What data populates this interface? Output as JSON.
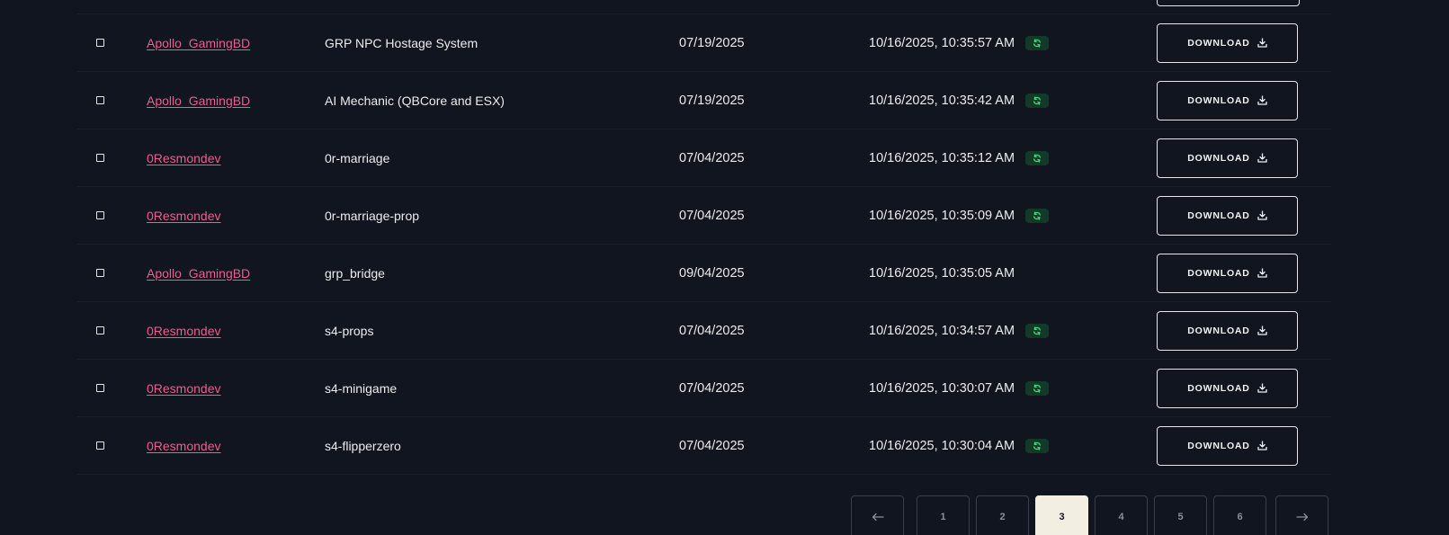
{
  "table": {
    "download_label": "DOWNLOAD",
    "rows": [
      {
        "author": "Apollo_GamingBD",
        "name": "GRP NPC Hostage System",
        "date": "07/19/2025",
        "updated": "10/16/2025, 10:35:57 AM",
        "synced": true
      },
      {
        "author": "Apollo_GamingBD",
        "name": "AI Mechanic (QBCore and ESX)",
        "date": "07/19/2025",
        "updated": "10/16/2025, 10:35:42 AM",
        "synced": true
      },
      {
        "author": "0Resmondev",
        "name": "0r-marriage",
        "date": "07/04/2025",
        "updated": "10/16/2025, 10:35:12 AM",
        "synced": true
      },
      {
        "author": "0Resmondev",
        "name": "0r-marriage-prop",
        "date": "07/04/2025",
        "updated": "10/16/2025, 10:35:09 AM",
        "synced": true
      },
      {
        "author": "Apollo_GamingBD",
        "name": "grp_bridge",
        "date": "09/04/2025",
        "updated": "10/16/2025, 10:35:05 AM",
        "synced": false
      },
      {
        "author": "0Resmondev",
        "name": "s4-props",
        "date": "07/04/2025",
        "updated": "10/16/2025, 10:34:57 AM",
        "synced": true
      },
      {
        "author": "0Resmondev",
        "name": "s4-minigame",
        "date": "07/04/2025",
        "updated": "10/16/2025, 10:30:07 AM",
        "synced": true
      },
      {
        "author": "0Resmondev",
        "name": "s4-flipperzero",
        "date": "07/04/2025",
        "updated": "10/16/2025, 10:30:04 AM",
        "synced": true
      }
    ]
  },
  "pagination": {
    "prev_icon": "arrow-left-icon",
    "next_icon": "arrow-right-icon",
    "pages": [
      "1",
      "2",
      "3",
      "4",
      "5",
      "6"
    ],
    "current": "3"
  },
  "colors": {
    "background": "#111520",
    "author_link": "#ea5f8e",
    "sync_badge_bg": "#133a26",
    "sync_icon": "#3ddc84",
    "active_page_bg": "#f2efe2"
  }
}
